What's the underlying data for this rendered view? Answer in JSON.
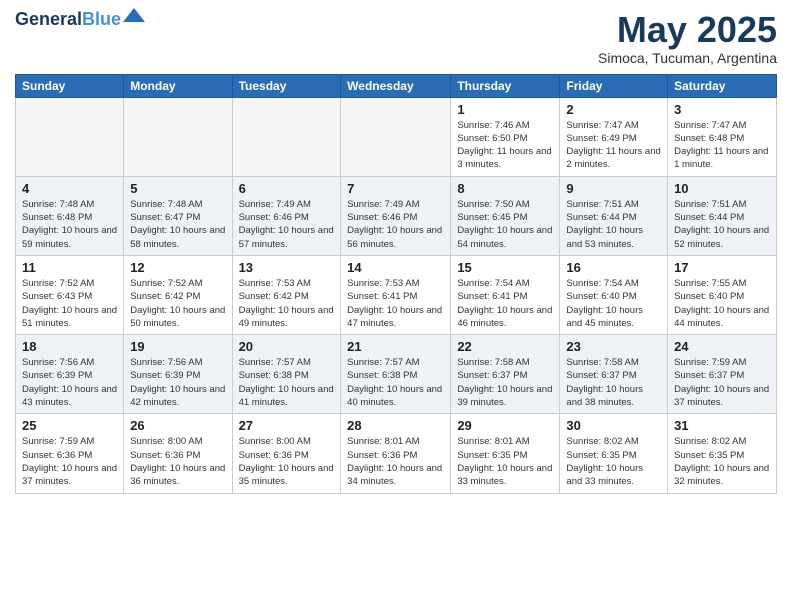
{
  "header": {
    "logo_line1": "General",
    "logo_line2": "Blue",
    "month_title": "May 2025",
    "subtitle": "Simoca, Tucuman, Argentina"
  },
  "weekdays": [
    "Sunday",
    "Monday",
    "Tuesday",
    "Wednesday",
    "Thursday",
    "Friday",
    "Saturday"
  ],
  "weeks": [
    [
      {
        "day": "",
        "info": ""
      },
      {
        "day": "",
        "info": ""
      },
      {
        "day": "",
        "info": ""
      },
      {
        "day": "",
        "info": ""
      },
      {
        "day": "1",
        "info": "Sunrise: 7:46 AM\nSunset: 6:50 PM\nDaylight: 11 hours and 3 minutes."
      },
      {
        "day": "2",
        "info": "Sunrise: 7:47 AM\nSunset: 6:49 PM\nDaylight: 11 hours and 2 minutes."
      },
      {
        "day": "3",
        "info": "Sunrise: 7:47 AM\nSunset: 6:48 PM\nDaylight: 11 hours and 1 minute."
      }
    ],
    [
      {
        "day": "4",
        "info": "Sunrise: 7:48 AM\nSunset: 6:48 PM\nDaylight: 10 hours and 59 minutes."
      },
      {
        "day": "5",
        "info": "Sunrise: 7:48 AM\nSunset: 6:47 PM\nDaylight: 10 hours and 58 minutes."
      },
      {
        "day": "6",
        "info": "Sunrise: 7:49 AM\nSunset: 6:46 PM\nDaylight: 10 hours and 57 minutes."
      },
      {
        "day": "7",
        "info": "Sunrise: 7:49 AM\nSunset: 6:46 PM\nDaylight: 10 hours and 56 minutes."
      },
      {
        "day": "8",
        "info": "Sunrise: 7:50 AM\nSunset: 6:45 PM\nDaylight: 10 hours and 54 minutes."
      },
      {
        "day": "9",
        "info": "Sunrise: 7:51 AM\nSunset: 6:44 PM\nDaylight: 10 hours and 53 minutes."
      },
      {
        "day": "10",
        "info": "Sunrise: 7:51 AM\nSunset: 6:44 PM\nDaylight: 10 hours and 52 minutes."
      }
    ],
    [
      {
        "day": "11",
        "info": "Sunrise: 7:52 AM\nSunset: 6:43 PM\nDaylight: 10 hours and 51 minutes."
      },
      {
        "day": "12",
        "info": "Sunrise: 7:52 AM\nSunset: 6:42 PM\nDaylight: 10 hours and 50 minutes."
      },
      {
        "day": "13",
        "info": "Sunrise: 7:53 AM\nSunset: 6:42 PM\nDaylight: 10 hours and 49 minutes."
      },
      {
        "day": "14",
        "info": "Sunrise: 7:53 AM\nSunset: 6:41 PM\nDaylight: 10 hours and 47 minutes."
      },
      {
        "day": "15",
        "info": "Sunrise: 7:54 AM\nSunset: 6:41 PM\nDaylight: 10 hours and 46 minutes."
      },
      {
        "day": "16",
        "info": "Sunrise: 7:54 AM\nSunset: 6:40 PM\nDaylight: 10 hours and 45 minutes."
      },
      {
        "day": "17",
        "info": "Sunrise: 7:55 AM\nSunset: 6:40 PM\nDaylight: 10 hours and 44 minutes."
      }
    ],
    [
      {
        "day": "18",
        "info": "Sunrise: 7:56 AM\nSunset: 6:39 PM\nDaylight: 10 hours and 43 minutes."
      },
      {
        "day": "19",
        "info": "Sunrise: 7:56 AM\nSunset: 6:39 PM\nDaylight: 10 hours and 42 minutes."
      },
      {
        "day": "20",
        "info": "Sunrise: 7:57 AM\nSunset: 6:38 PM\nDaylight: 10 hours and 41 minutes."
      },
      {
        "day": "21",
        "info": "Sunrise: 7:57 AM\nSunset: 6:38 PM\nDaylight: 10 hours and 40 minutes."
      },
      {
        "day": "22",
        "info": "Sunrise: 7:58 AM\nSunset: 6:37 PM\nDaylight: 10 hours and 39 minutes."
      },
      {
        "day": "23",
        "info": "Sunrise: 7:58 AM\nSunset: 6:37 PM\nDaylight: 10 hours and 38 minutes."
      },
      {
        "day": "24",
        "info": "Sunrise: 7:59 AM\nSunset: 6:37 PM\nDaylight: 10 hours and 37 minutes."
      }
    ],
    [
      {
        "day": "25",
        "info": "Sunrise: 7:59 AM\nSunset: 6:36 PM\nDaylight: 10 hours and 37 minutes."
      },
      {
        "day": "26",
        "info": "Sunrise: 8:00 AM\nSunset: 6:36 PM\nDaylight: 10 hours and 36 minutes."
      },
      {
        "day": "27",
        "info": "Sunrise: 8:00 AM\nSunset: 6:36 PM\nDaylight: 10 hours and 35 minutes."
      },
      {
        "day": "28",
        "info": "Sunrise: 8:01 AM\nSunset: 6:36 PM\nDaylight: 10 hours and 34 minutes."
      },
      {
        "day": "29",
        "info": "Sunrise: 8:01 AM\nSunset: 6:35 PM\nDaylight: 10 hours and 33 minutes."
      },
      {
        "day": "30",
        "info": "Sunrise: 8:02 AM\nSunset: 6:35 PM\nDaylight: 10 hours and 33 minutes."
      },
      {
        "day": "31",
        "info": "Sunrise: 8:02 AM\nSunset: 6:35 PM\nDaylight: 10 hours and 32 minutes."
      }
    ]
  ]
}
